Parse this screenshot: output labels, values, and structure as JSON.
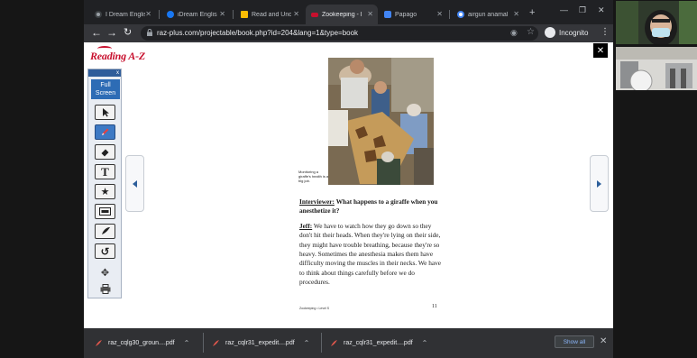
{
  "tabs": [
    {
      "label": "I Dream Englis",
      "favicon_color": "#9aa0a6"
    },
    {
      "label": "iDream Englis",
      "favicon_color": "#1877f2"
    },
    {
      "label": "Read and Und",
      "favicon_color": "#fbbc04"
    },
    {
      "label": "Zookeeping - I",
      "favicon_color": "#c8102e",
      "active": true
    },
    {
      "label": "Papago",
      "favicon_color": "#4285f4"
    },
    {
      "label": "airgun anamal",
      "favicon_color": "#ffffff"
    }
  ],
  "toolbar": {
    "url": "raz-plus.com/projectable/book.php?id=204&lang=1&type=book",
    "incognito_label": "Incognito"
  },
  "site": {
    "logo": "Reading A-Z",
    "logo_color": "#c8102e"
  },
  "tool_panel": {
    "close": "x",
    "full_screen": [
      "Full",
      "Screen"
    ],
    "tools": [
      {
        "name": "pointer-tool",
        "icon": "pointer-icon"
      },
      {
        "name": "pen-tool",
        "icon": "pen-icon",
        "selected": true
      },
      {
        "name": "eraser-tool",
        "icon": "eraser-icon"
      },
      {
        "name": "text-tool",
        "icon": "text-icon"
      },
      {
        "name": "star-tool",
        "icon": "star-icon"
      },
      {
        "name": "mask-tool",
        "icon": "mask-icon"
      },
      {
        "name": "clear-tool",
        "icon": "clear-icon"
      },
      {
        "name": "undo-tool",
        "icon": "undo-icon"
      },
      {
        "name": "move-tool",
        "icon": "move-icon"
      },
      {
        "name": "print-tool",
        "icon": "print-icon"
      }
    ]
  },
  "page": {
    "photo_caption": "Monitoring a giraffe's health is a big job.",
    "interviewer_label": "Interviewer:",
    "question": "What happens to a giraffe when you anesthetize it?",
    "speaker_label": "Jeff:",
    "answer": "We have to watch how they go down so they don't hit their heads. When they're lying on their side, they might have trouble breathing, because they're so heavy. Sometimes the anesthesia makes them have difficulty moving the muscles in their necks. We have to think about things carefully before we do procedures.",
    "footer": "Zookeeping • Level S",
    "page_number": "11"
  },
  "downloads": [
    {
      "name": "raz_cqlg30_groun....pdf"
    },
    {
      "name": "raz_cqlr31_expedit....pdf"
    },
    {
      "name": "raz_cqlr31_expedit....pdf"
    }
  ],
  "downloads_bar": {
    "show_all": "Show all"
  }
}
